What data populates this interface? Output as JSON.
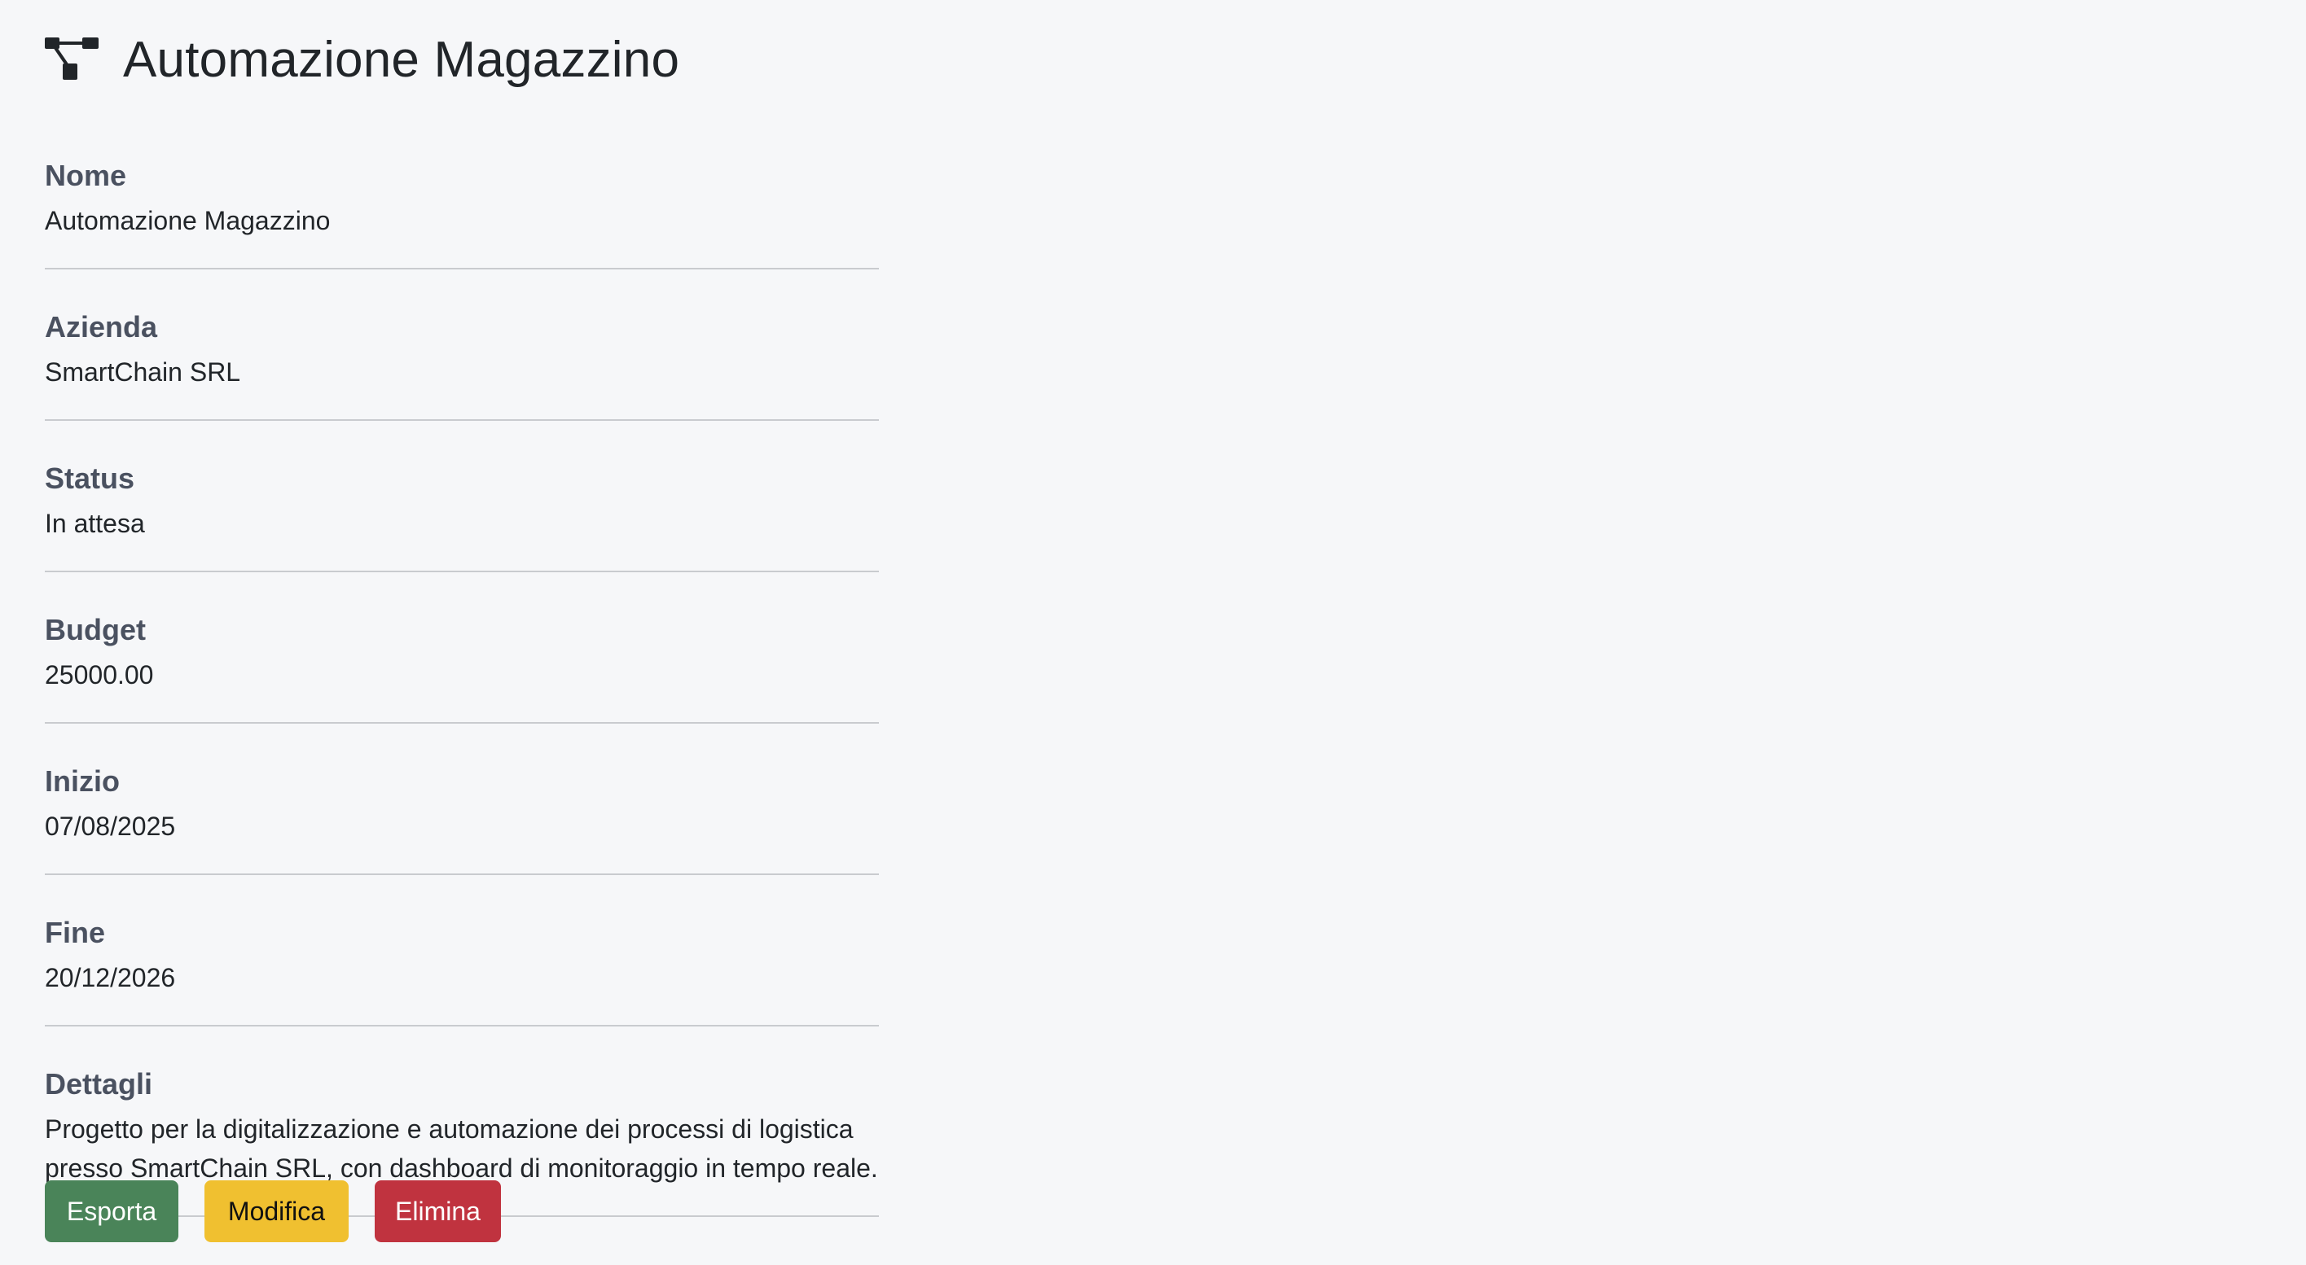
{
  "header": {
    "icon": "project-diagram-icon",
    "title": "Automazione Magazzino"
  },
  "fields": [
    {
      "label": "Nome",
      "value": "Automazione Magazzino"
    },
    {
      "label": "Azienda",
      "value": "SmartChain SRL"
    },
    {
      "label": "Status",
      "value": "In attesa"
    },
    {
      "label": "Budget",
      "value": "25000.00"
    },
    {
      "label": "Inizio",
      "value": "07/08/2025"
    },
    {
      "label": "Fine",
      "value": "20/12/2026"
    },
    {
      "label": "Dettagli",
      "value": "Progetto per la digitalizzazione e automazione dei processi di logistica presso SmartChain SRL, con dashboard di monitoraggio in tempo reale."
    }
  ],
  "actions": {
    "export_label": "Esporta",
    "edit_label": "Modifica",
    "delete_label": "Elimina"
  },
  "colors": {
    "background": "#f6f7f9",
    "export": "#4a8459",
    "edit": "#f0c030",
    "delete": "#c0333f"
  }
}
